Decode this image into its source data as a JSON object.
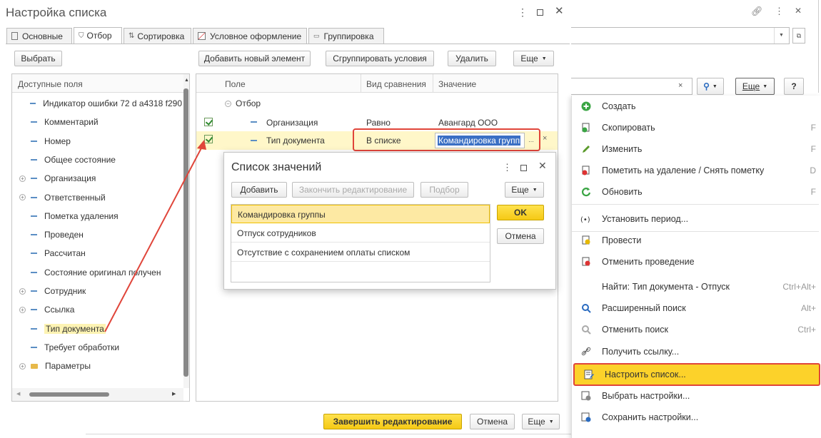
{
  "window": {
    "title": "Настройка списка"
  },
  "tabs": [
    {
      "label": "Основные",
      "icon": "document-icon"
    },
    {
      "label": "Отбор",
      "icon": "filter-icon"
    },
    {
      "label": "Сортировка",
      "icon": "sort-icon"
    },
    {
      "label": "Условное оформление",
      "icon": "conditional-format-icon"
    },
    {
      "label": "Группировка",
      "icon": "grouping-icon"
    }
  ],
  "left": {
    "select_button": "Выбрать",
    "header": "Доступные поля",
    "fields": [
      {
        "label": "Индикатор ошибки 72 d a4318 f290",
        "expand": false
      },
      {
        "label": "Комментарий",
        "expand": false
      },
      {
        "label": "Номер",
        "expand": false
      },
      {
        "label": "Общее состояние",
        "expand": false
      },
      {
        "label": "Организация",
        "expand": true
      },
      {
        "label": "Ответственный",
        "expand": true
      },
      {
        "label": "Пометка удаления",
        "expand": false
      },
      {
        "label": "Проведен",
        "expand": false
      },
      {
        "label": "Рассчитан",
        "expand": false
      },
      {
        "label": "Состояние оригинал получен",
        "expand": false
      },
      {
        "label": "Сотрудник",
        "expand": true
      },
      {
        "label": "Ссылка",
        "expand": true
      },
      {
        "label": "Тип документа",
        "expand": false
      },
      {
        "label": "Требует обработки",
        "expand": false
      },
      {
        "label": "Параметры",
        "expand": true
      }
    ]
  },
  "right": {
    "toolbar": {
      "add": "Добавить новый элемент",
      "group": "Сгруппировать условия",
      "delete": "Удалить",
      "more": "Еще"
    },
    "columns": {
      "field": "Поле",
      "comparison": "Вид сравнения",
      "value": "Значение"
    },
    "group_label": "Отбор",
    "rows": [
      {
        "field": "Организация",
        "comparison": "Равно",
        "value": "Авангард ООО"
      },
      {
        "field": "Тип документа",
        "comparison": "В списке",
        "value": "Командировка группы"
      }
    ],
    "ellipsis": "...",
    "clear": "×"
  },
  "dialog": {
    "title": "Список значений",
    "add": "Добавить",
    "finish_edit": "Закончить редактирование",
    "pick": "Подбор",
    "more": "Еще",
    "items": [
      "Командировка группы",
      "Отпуск сотрудников",
      "Отсутствие с сохранением оплаты списком"
    ],
    "ok": "OK",
    "cancel": "Отмена"
  },
  "footer": {
    "finish": "Завершить редактирование",
    "cancel": "Отмена",
    "more": "Еще"
  },
  "menu": {
    "search_clear": "×",
    "more": "Еще",
    "help": "?",
    "items": [
      {
        "label": "Создать",
        "icon": "plus-circle-icon",
        "key": ""
      },
      {
        "label": "Скопировать",
        "icon": "copy-icon",
        "key": "F"
      },
      {
        "label": "Изменить",
        "icon": "pencil-icon",
        "key": "F"
      },
      {
        "label": "Пометить на удаление / Снять пометку",
        "icon": "delete-mark-icon",
        "key": "D"
      },
      {
        "label": "Обновить",
        "icon": "refresh-icon",
        "key": "F"
      },
      {
        "label": "Установить период...",
        "icon": "period-icon",
        "key": ""
      },
      {
        "label": "Провести",
        "icon": "post-icon",
        "key": ""
      },
      {
        "label": "Отменить проведение",
        "icon": "unpost-icon",
        "key": ""
      },
      {
        "label": "Найти: Тип документа - Отпуск",
        "icon": "",
        "key": "Ctrl+Alt+"
      },
      {
        "label": "Расширенный поиск",
        "icon": "search-icon",
        "key": "Alt+"
      },
      {
        "label": "Отменить поиск",
        "icon": "cancel-search-icon",
        "key": "Ctrl+"
      },
      {
        "label": "Получить ссылку...",
        "icon": "link-icon",
        "key": ""
      },
      {
        "label": "Настроить список...",
        "icon": "list-settings-icon",
        "key": ""
      },
      {
        "label": "Выбрать настройки...",
        "icon": "choose-settings-icon",
        "key": ""
      },
      {
        "label": "Сохранить настройки...",
        "icon": "save-settings-icon",
        "key": ""
      }
    ]
  },
  "colors": {
    "accent_red": "#e0453a",
    "highlight_yellow": "#fcd22a",
    "selection_blue": "#3a6fc4"
  }
}
